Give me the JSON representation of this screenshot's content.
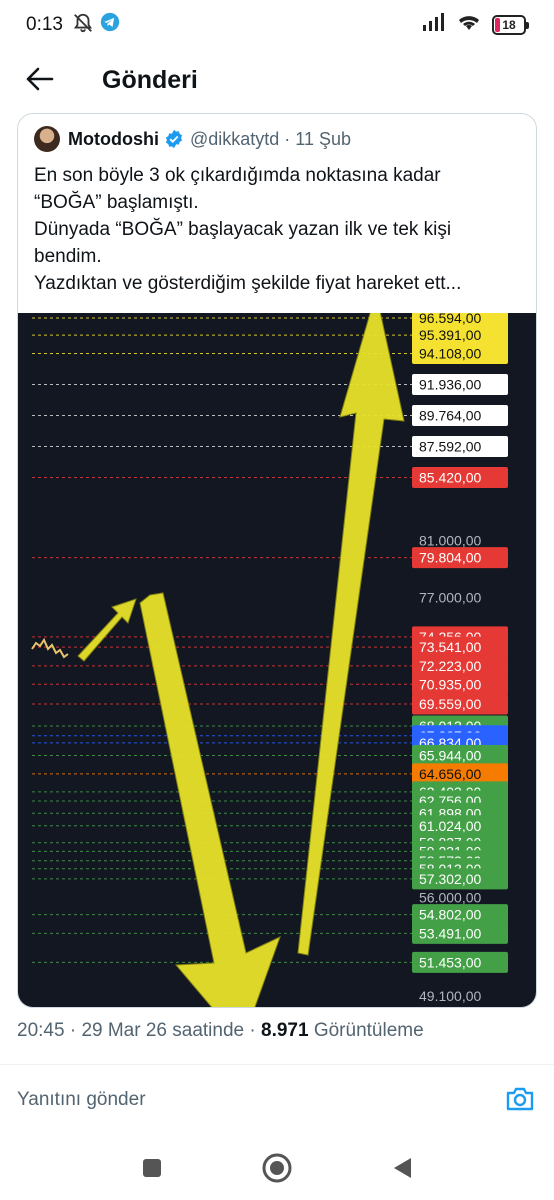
{
  "status_bar": {
    "time": "0:13",
    "battery": "18",
    "icons": [
      "mute-icon",
      "telegram-icon",
      "signal-icon",
      "wifi-icon",
      "battery-icon"
    ]
  },
  "header": {
    "title": "Gönderi",
    "back_icon": "arrow-left-icon"
  },
  "quoted_post": {
    "author_name": "Motodoshi",
    "handle": "@dikkatytd",
    "separator": "·",
    "date": "11 Şub",
    "text_lines": [
      "En son böyle 3 ok çıkardığımda noktasına kadar",
      "“BOĞA” başlamıştı.",
      "Dünyada “BOĞA” başlayacak yazan ilk ve tek kişi",
      "bendim.",
      "Yazdıktan ve gösterdiğim şekilde fiyat hareket ett..."
    ]
  },
  "chart_data": {
    "type": "price-levels",
    "background": "#131722",
    "price_labels": [
      {
        "text": "96.594,00",
        "color": "#f5e130",
        "text_color": "#111111"
      },
      {
        "text": "95.391,00",
        "color": "#f5e130",
        "text_color": "#111111"
      },
      {
        "text": "94.108,00",
        "color": "#f5e130",
        "text_color": "#111111"
      },
      {
        "text": "91.936,00",
        "color": "#ffffff",
        "text_color": "#111111"
      },
      {
        "text": "89.764,00",
        "color": "#ffffff",
        "text_color": "#111111"
      },
      {
        "text": "87.592,00",
        "color": "#ffffff",
        "text_color": "#111111"
      },
      {
        "text": "85.420,00",
        "color": "#e53935",
        "text_color": "#ffffff"
      },
      {
        "text": "81.000,00",
        "color": null,
        "text_color": "#b2b5be"
      },
      {
        "text": "79.804,00",
        "color": "#e53935",
        "text_color": "#ffffff"
      },
      {
        "text": "77.000,00",
        "color": null,
        "text_color": "#b2b5be"
      },
      {
        "text": "74.256,00",
        "color": "#e53935",
        "text_color": "#ffffff"
      },
      {
        "text": "73.541,00",
        "color": "#e53935",
        "text_color": "#ffffff"
      },
      {
        "text": "72.223,00",
        "color": "#e53935",
        "text_color": "#ffffff"
      },
      {
        "text": "70.935,00",
        "color": "#e53935",
        "text_color": "#ffffff"
      },
      {
        "text": "69.559,00",
        "color": "#e53935",
        "text_color": "#ffffff"
      },
      {
        "text": "68.012,00",
        "color": "#43a047",
        "text_color": "#ffffff"
      },
      {
        "text": "67.327,00",
        "color": "#2962ff",
        "text_color": "#ffffff"
      },
      {
        "text": "66.834,00",
        "color": "#2962ff",
        "text_color": "#ffffff"
      },
      {
        "text": "65.944,00",
        "color": "#43a047",
        "text_color": "#ffffff"
      },
      {
        "text": "64.656,00",
        "color": "#f57c00",
        "text_color": "#111111"
      },
      {
        "text": "63.403,00",
        "color": "#43a047",
        "text_color": "#ffffff"
      },
      {
        "text": "62.756,00",
        "color": "#43a047",
        "text_color": "#ffffff"
      },
      {
        "text": "61.898,00",
        "color": "#43a047",
        "text_color": "#ffffff"
      },
      {
        "text": "61.024,00",
        "color": "#43a047",
        "text_color": "#ffffff"
      },
      {
        "text": "59.837,00",
        "color": "#43a047",
        "text_color": "#ffffff"
      },
      {
        "text": "59.231,00",
        "color": "#43a047",
        "text_color": "#ffffff"
      },
      {
        "text": "58.573,00",
        "color": "#43a047",
        "text_color": "#ffffff"
      },
      {
        "text": "58.013,00",
        "color": "#43a047",
        "text_color": "#ffffff"
      },
      {
        "text": "57.302,00",
        "color": "#43a047",
        "text_color": "#ffffff"
      },
      {
        "text": "56.000,00",
        "color": null,
        "text_color": "#b2b5be"
      },
      {
        "text": "54.802,00",
        "color": "#43a047",
        "text_color": "#ffffff"
      },
      {
        "text": "53.491,00",
        "color": "#43a047",
        "text_color": "#ffffff"
      },
      {
        "text": "51.453,00",
        "color": "#43a047",
        "text_color": "#ffffff"
      },
      {
        "text": "49.100,00",
        "color": null,
        "text_color": "#b2b5be"
      }
    ],
    "arrows": [
      {
        "direction": "up-right",
        "color": "#e8e22a"
      },
      {
        "direction": "down",
        "color": "#e8e22a"
      },
      {
        "direction": "up",
        "color": "#e8e22a"
      }
    ]
  },
  "meta": {
    "time": "20:45",
    "date": "29 Mar 26 saatinde",
    "views_count": "8.971",
    "views_label": "Görüntüleme"
  },
  "reply": {
    "placeholder": "Yanıtını gönder",
    "camera_icon": "camera-icon"
  },
  "nav_bar": {
    "buttons": [
      "square-recents-icon",
      "circle-home-icon",
      "triangle-back-icon"
    ]
  },
  "colors": {
    "verified_blue": "#1d9bf0",
    "text_secondary": "#536471",
    "arrow_yellow": "#e8e22a"
  }
}
